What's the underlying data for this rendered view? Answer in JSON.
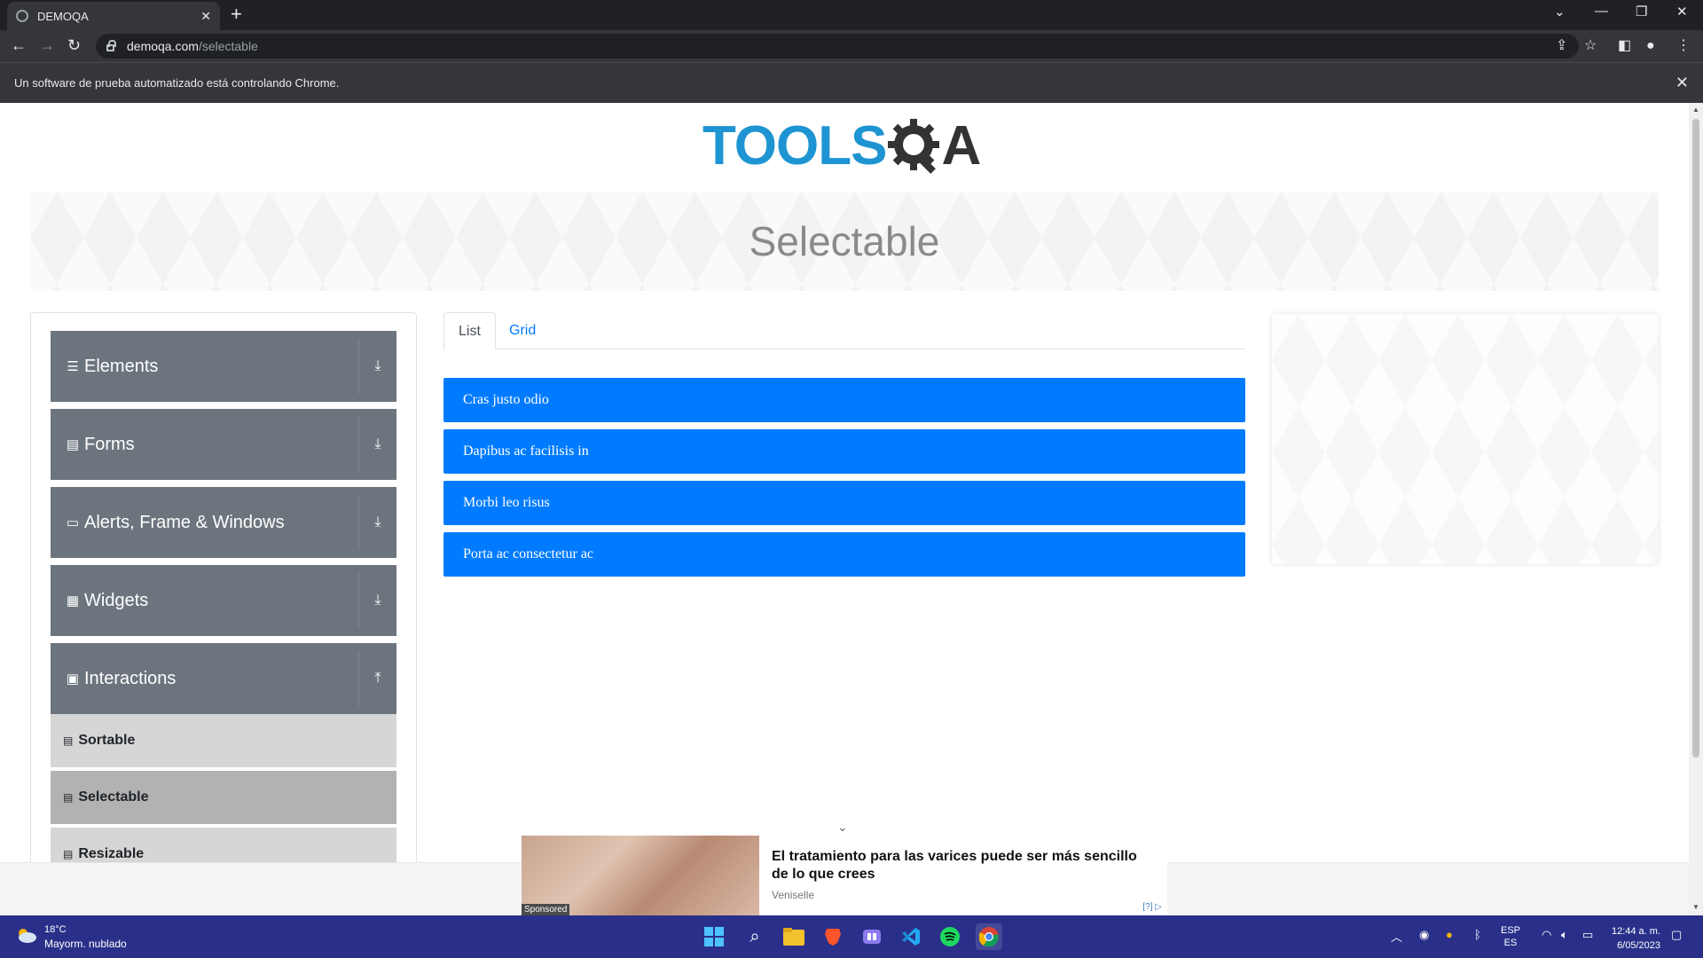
{
  "browser": {
    "tab_title": "DEMOQA",
    "new_tab": "+",
    "url_host": "demoqa.com",
    "url_path": "/selectable",
    "infobar_text": "Un software de prueba automatizado está controlando Chrome.",
    "infobar_close": "✕"
  },
  "logo": {
    "text": "TOOLS",
    "suffix": "A"
  },
  "page": {
    "title": "Selectable"
  },
  "sidebar": {
    "groups": [
      {
        "label": "Elements",
        "icon": "hamburger-icon"
      },
      {
        "label": "Forms",
        "icon": "form-icon"
      },
      {
        "label": "Alerts, Frame & Windows",
        "icon": "window-icon"
      },
      {
        "label": "Widgets",
        "icon": "widgets-icon"
      },
      {
        "label": "Interactions",
        "icon": "interactions-icon"
      }
    ],
    "sub_items": [
      {
        "label": "Sortable"
      },
      {
        "label": "Selectable"
      },
      {
        "label": "Resizable"
      }
    ]
  },
  "tabs": [
    {
      "label": "List"
    },
    {
      "label": "Grid"
    }
  ],
  "list_items": [
    "Cras justo odio",
    "Dapibus ac facilisis in",
    "Morbi leo risus",
    "Porta ac consectetur ac"
  ],
  "ad": {
    "headline": "El tratamiento para las varices puede ser más sencillo de lo que crees",
    "source": "Veniselle",
    "sponsored": "Sponsored",
    "choices": "[?]"
  },
  "taskbar": {
    "temperature": "18°C",
    "weather": "Mayorm. nublado",
    "lang_top": "ESP",
    "lang_bottom": "ES",
    "time": "12:44 a. m.",
    "date": "6/05/2023"
  },
  "colors": {
    "accent": "#007bff",
    "sidebar": "#6c757d",
    "taskbar": "#2a3089",
    "logo": "#1e94d2"
  }
}
